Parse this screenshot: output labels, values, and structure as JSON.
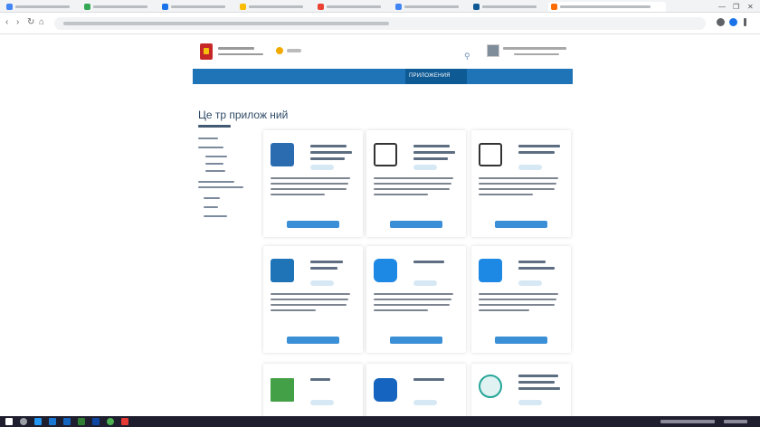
{
  "browser": {
    "tabs": [
      {
        "fav": "#4285f4",
        "active": false
      },
      {
        "fav": "#34a853",
        "active": false
      },
      {
        "fav": "#1a73e8",
        "active": false
      },
      {
        "fav": "#fbbc04",
        "active": false
      },
      {
        "fav": "#ea4335",
        "active": false
      },
      {
        "fav": "#4285f4",
        "active": false
      },
      {
        "fav": "#0d5a95",
        "active": false
      },
      {
        "fav": "#ff6d00",
        "active": true
      }
    ],
    "window_controls": [
      "—",
      "❐",
      "✕"
    ],
    "nav": {
      "back": "‹",
      "forward": "›",
      "reload": "↻",
      "home": "⌂"
    },
    "address": "",
    "extension_colors": [
      "#5f6368",
      "#1a73e8",
      "#5f6368"
    ]
  },
  "site": {
    "brand_line1": "",
    "brand_line2": "",
    "search_icon": "search-icon",
    "user_name": "",
    "nav": [
      {
        "label": "",
        "active": false
      },
      {
        "label": "",
        "active": false
      },
      {
        "label": "",
        "active": false
      },
      {
        "label": "",
        "active": false
      },
      {
        "label": "",
        "active": false
      },
      {
        "label": "ПРИЛОЖЕНИЯ",
        "active": true
      }
    ],
    "page_title": "Це тр прилож ний",
    "accent": "#1f73b7",
    "accent_active": "#0d5a95",
    "button_color": "#3b8fd6",
    "cards": [
      {
        "title": "",
        "icon_color": "#2b6cb0",
        "icon": "people-icon",
        "button": ""
      },
      {
        "title": "",
        "icon_color": "#ffffff",
        "icon": "monitor-icon",
        "button": ""
      },
      {
        "title": "",
        "icon_color": "#ffffff",
        "icon": "monitor-icon",
        "button": ""
      },
      {
        "title": "",
        "icon_color": "#1f73b7",
        "icon": "app-logo-icon",
        "button": ""
      },
      {
        "title": "",
        "icon_color": "#1e88e5",
        "icon": "mail-icon",
        "button": ""
      },
      {
        "title": "",
        "icon_color": "#1e88e5",
        "icon": "building-icon",
        "button": ""
      },
      {
        "title": "",
        "icon_color": "#43a047",
        "icon": "book-icon",
        "button": ""
      },
      {
        "title": "",
        "icon_color": "#1565c0",
        "icon": "chat-icon",
        "button": ""
      },
      {
        "title": "",
        "icon_color": "#26a69a",
        "icon": "map-icon",
        "button": ""
      }
    ]
  },
  "taskbar": {
    "icons": [
      "#ffffff",
      "#9aa0a6",
      "#2196f3",
      "#1976d2",
      "#1565c0",
      "#2e7d32",
      "#0d47a1",
      "#4caf50",
      "#e53935"
    ],
    "clock": ""
  }
}
